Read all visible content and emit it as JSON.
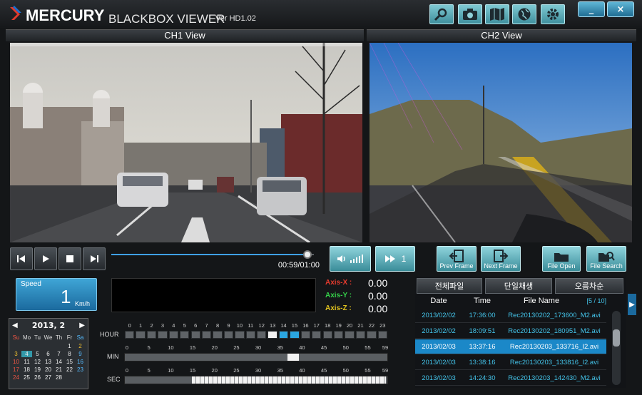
{
  "app": {
    "brand": "MERCURY",
    "subtitle": "BLACKBOX VIEWER",
    "version": "Ver HD1.02",
    "toolbar_icons": [
      "search-icon",
      "camera-icon",
      "map-icon",
      "globe-icon",
      "gear-icon"
    ]
  },
  "window": {
    "minimize_label": "_",
    "close_label": "×"
  },
  "channels": {
    "ch1_title": "CH1 View",
    "ch2_title": "CH2 View"
  },
  "playback": {
    "time_display": "00:59/01:00",
    "progress": 0.97,
    "volume_icon": "speaker-icon",
    "speed_value": "1",
    "buttons": {
      "prev_frame": "Prev Frame",
      "next_frame": "Next Frame",
      "file_open": "File Open",
      "file_search": "File Search"
    }
  },
  "speed": {
    "label": "Speed",
    "value": "1",
    "unit": "Km/h"
  },
  "axis": {
    "x_label": "Axis-X :",
    "x_value": "0.00",
    "y_label": "Axis-Y :",
    "y_value": "0.00",
    "z_label": "Axis-Z :",
    "z_value": "0.00",
    "x_color": "#e53b2e",
    "y_color": "#35d04a",
    "z_color": "#e0c21f"
  },
  "calendar": {
    "month_label": "2013, 2",
    "weekdays": [
      "Su",
      "Mo",
      "Tu",
      "We",
      "Th",
      "Fr",
      "Sa"
    ],
    "weeks": [
      [
        "",
        "",
        "",
        "",
        "",
        "1",
        "2"
      ],
      [
        "3",
        "4",
        "5",
        "6",
        "7",
        "8",
        "9"
      ],
      [
        "10",
        "11",
        "12",
        "13",
        "14",
        "15",
        "16"
      ],
      [
        "17",
        "18",
        "19",
        "20",
        "21",
        "22",
        "23"
      ],
      [
        "24",
        "25",
        "26",
        "27",
        "28",
        "",
        ""
      ]
    ]
  },
  "timeline": {
    "hour_label": "HOUR",
    "min_label": "MIN",
    "sec_label": "SEC",
    "hour_ticks": [
      "0",
      "1",
      "2",
      "3",
      "4",
      "5",
      "6",
      "7",
      "8",
      "9",
      "10",
      "11",
      "12",
      "13",
      "14",
      "15",
      "16",
      "17",
      "18",
      "19",
      "20",
      "21",
      "22",
      "23"
    ],
    "min_ticks": [
      "0",
      "5",
      "10",
      "15",
      "20",
      "25",
      "30",
      "35",
      "40",
      "45",
      "50",
      "55",
      "59"
    ],
    "sec_ticks": [
      "0",
      "5",
      "10",
      "15",
      "20",
      "25",
      "30",
      "35",
      "40",
      "45",
      "50",
      "55",
      "59"
    ],
    "hours_recorded": [
      13,
      14,
      15
    ],
    "hour_selected": 13
  },
  "files": {
    "tabs": [
      "전체파일",
      "단일채생",
      "오름차순"
    ],
    "headers": {
      "date": "Date",
      "time": "Time",
      "name": "File Name"
    },
    "page": "[5 / 10]",
    "rows": [
      {
        "date": "2013/02/02",
        "time": "17:36:00",
        "name": "Rec20130202_173600_M2.avi",
        "selected": false
      },
      {
        "date": "2013/02/02",
        "time": "18:09:51",
        "name": "Rec20130202_180951_M2.avi",
        "selected": false
      },
      {
        "date": "2013/02/03",
        "time": "13:37:16",
        "name": "Rec20130203_133716_I2.avi",
        "selected": true
      },
      {
        "date": "2013/02/03",
        "time": "13:38:16",
        "name": "Rec20130203_133816_I2.avi",
        "selected": false
      },
      {
        "date": "2013/02/03",
        "time": "14:24:30",
        "name": "Rec20130203_142430_M2.avi",
        "selected": false
      }
    ]
  }
}
